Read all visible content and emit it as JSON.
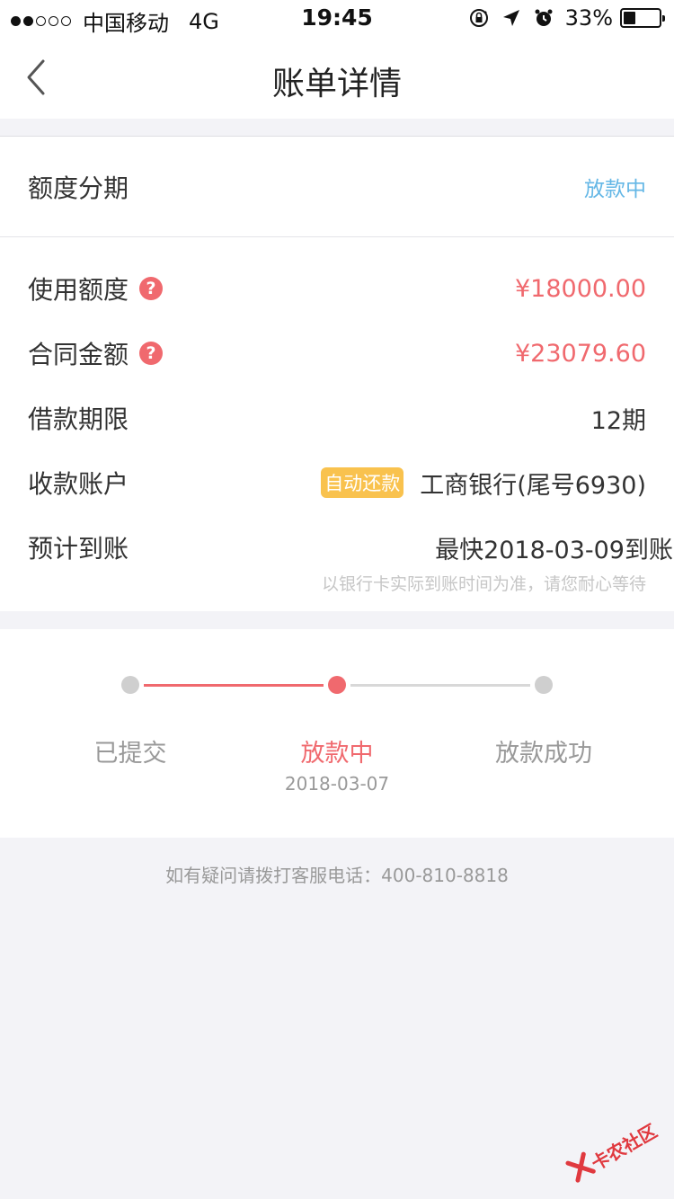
{
  "status_bar": {
    "carrier": "中国移动",
    "network": "4G",
    "time": "19:45",
    "battery_percent": "33%",
    "battery_level": 0.33,
    "icons": [
      "orientation-lock-icon",
      "location-arrow-icon",
      "alarm-icon"
    ]
  },
  "nav": {
    "title": "账单详情",
    "back_icon": "chevron-left-icon"
  },
  "bill": {
    "type_label": "额度分期",
    "status": "放款中",
    "rows": {
      "used_quota": {
        "label": "使用额度",
        "value": "¥18000.00"
      },
      "contract_amount": {
        "label": "合同金额",
        "value": "¥23079.60"
      },
      "loan_term": {
        "label": "借款期限",
        "value": "12期"
      },
      "account": {
        "label": "收款账户",
        "badge": "自动还款",
        "value": "工商银行(尾号6930)"
      },
      "eta": {
        "label": "预计到账",
        "value": "最快2018-03-09到账",
        "note": "以银行卡实际到账时间为准，请您耐心等待"
      }
    },
    "help_icon_char": "?"
  },
  "progress": {
    "steps": [
      {
        "label": "已提交",
        "date": ""
      },
      {
        "label": "放款中",
        "date": "2018-03-07"
      },
      {
        "label": "放款成功",
        "date": ""
      }
    ],
    "current_step": 1
  },
  "footer": {
    "hotline": "如有疑问请拨打客服电话：400-810-8818"
  },
  "watermark": {
    "text": "卡农社区"
  },
  "colors": {
    "accent": "#f0696e",
    "status_blue": "#64b7e6",
    "badge": "#f9c24e",
    "background": "#f3f3f7"
  }
}
